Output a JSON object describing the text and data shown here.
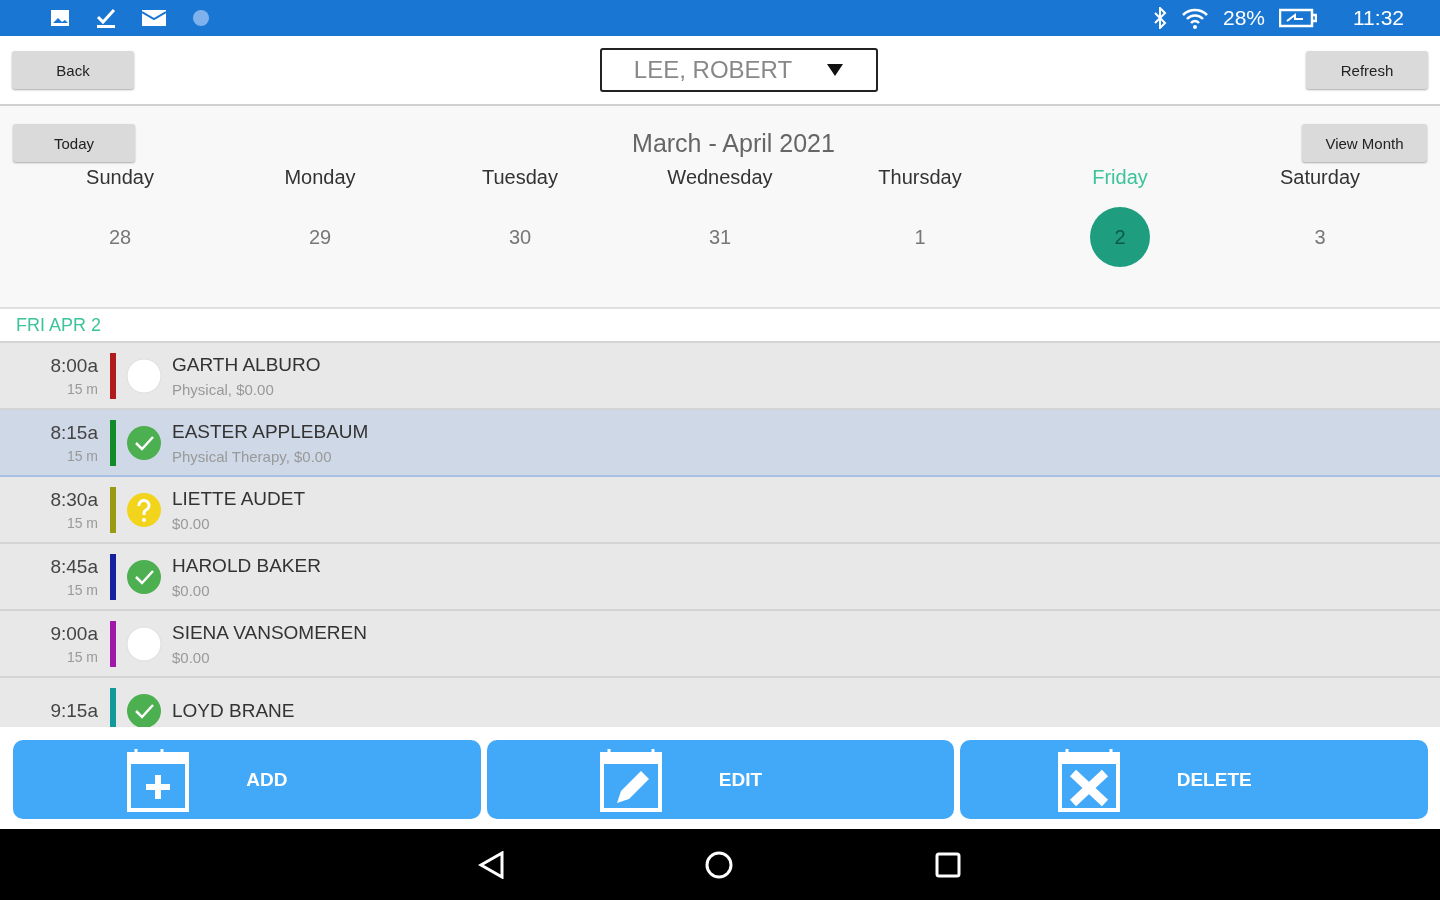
{
  "status_bar": {
    "battery": "28%",
    "time": "11:32"
  },
  "header": {
    "back": "Back",
    "provider": "LEE, ROBERT",
    "refresh": "Refresh"
  },
  "calendar": {
    "today": "Today",
    "title": "March - April 2021",
    "view_month": "View Month",
    "days": [
      {
        "name": "Sunday",
        "date": "28",
        "selected": false
      },
      {
        "name": "Monday",
        "date": "29",
        "selected": false
      },
      {
        "name": "Tuesday",
        "date": "30",
        "selected": false
      },
      {
        "name": "Wednesday",
        "date": "31",
        "selected": false
      },
      {
        "name": "Thursday",
        "date": "1",
        "selected": false
      },
      {
        "name": "Friday",
        "date": "2",
        "selected": true
      },
      {
        "name": "Saturday",
        "date": "3",
        "selected": false
      }
    ]
  },
  "date_label": "FRI APR 2",
  "appointments": [
    {
      "time": "8:00a",
      "duration": "15 m",
      "color": "#b01c1c",
      "kind": "none",
      "name": "GARTH ALBURO",
      "detail": "Physical, $0.00",
      "selected": false
    },
    {
      "time": "8:15a",
      "duration": "15 m",
      "color": "#118a2a",
      "kind": "done",
      "name": "EASTER APPLEBAUM",
      "detail": "Physical Therapy, $0.00",
      "selected": true
    },
    {
      "time": "8:30a",
      "duration": "15 m",
      "color": "#9a9a12",
      "kind": "unknown",
      "name": "LIETTE AUDET",
      "detail": "$0.00",
      "selected": false
    },
    {
      "time": "8:45a",
      "duration": "15 m",
      "color": "#1420a0",
      "kind": "done",
      "name": "HAROLD BAKER",
      "detail": "$0.00",
      "selected": false
    },
    {
      "time": "9:00a",
      "duration": "15 m",
      "color": "#a018a8",
      "kind": "none",
      "name": "SIENA VANSOMEREN",
      "detail": "$0.00",
      "selected": false
    },
    {
      "time": "9:15a",
      "color": "#129a9a",
      "kind": "done",
      "name": "LOYD BRANE",
      "selected": false
    }
  ],
  "actions": [
    {
      "kind": "add",
      "label": "ADD"
    },
    {
      "kind": "edit",
      "label": "EDIT"
    },
    {
      "kind": "delete",
      "label": "DELETE"
    }
  ]
}
